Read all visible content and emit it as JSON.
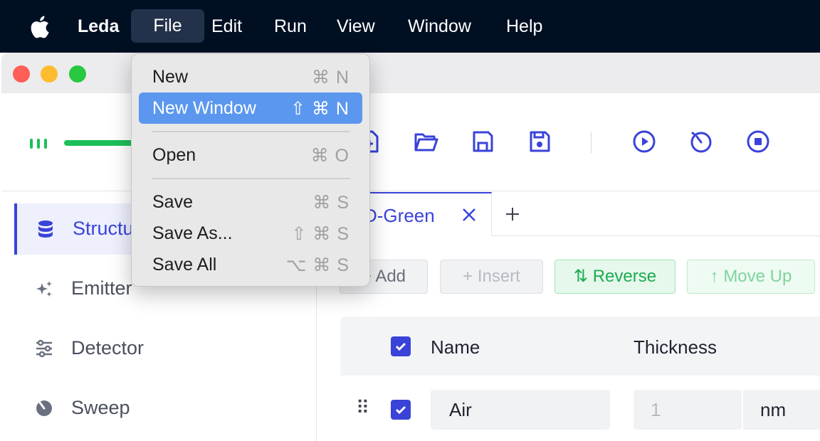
{
  "menubar": {
    "app_name": "Leda",
    "menus": [
      "File",
      "Edit",
      "Run",
      "View",
      "Window",
      "Help"
    ],
    "active_menu": "File"
  },
  "sidebar": {
    "items": [
      {
        "label": "Structure",
        "icon": "database-icon",
        "active": true
      },
      {
        "label": "Emitter",
        "icon": "sparkle-icon",
        "active": false
      },
      {
        "label": "Detector",
        "icon": "sliders-icon",
        "active": false
      },
      {
        "label": "Sweep",
        "icon": "sweep-icon",
        "active": false
      }
    ]
  },
  "toolbar": {
    "icons": [
      "new-file-icon",
      "open-folder-icon",
      "save-icon",
      "save-all-icon",
      "run-icon",
      "timer-icon",
      "stop-icon"
    ]
  },
  "tabs": {
    "items": [
      {
        "label": "D-Green"
      }
    ],
    "add_label": "+"
  },
  "actions": {
    "add": "Add",
    "insert": "Insert",
    "reverse": "Reverse",
    "move_up": "Move Up"
  },
  "table": {
    "headers": {
      "name": "Name",
      "thickness": "Thickness"
    },
    "rows": [
      {
        "name": "Air",
        "thickness": "1",
        "unit": "nm"
      }
    ]
  },
  "file_menu": {
    "items": [
      {
        "label": "New",
        "shortcut": "⌘ N"
      },
      {
        "label": "New Window",
        "shortcut": "⇧ ⌘ N",
        "highlighted": true
      },
      {
        "label": "Open",
        "shortcut": "⌘ O"
      },
      {
        "label": "Save",
        "shortcut": "⌘ S"
      },
      {
        "label": "Save As...",
        "shortcut": "⇧ ⌘ S"
      },
      {
        "label": "Save All",
        "shortcut": "⌥ ⌘ S"
      }
    ]
  },
  "colors": {
    "accent": "#3a43d8",
    "success": "#1cab52",
    "menu_highlight": "#5b97ee",
    "menubar": "#010f23"
  }
}
